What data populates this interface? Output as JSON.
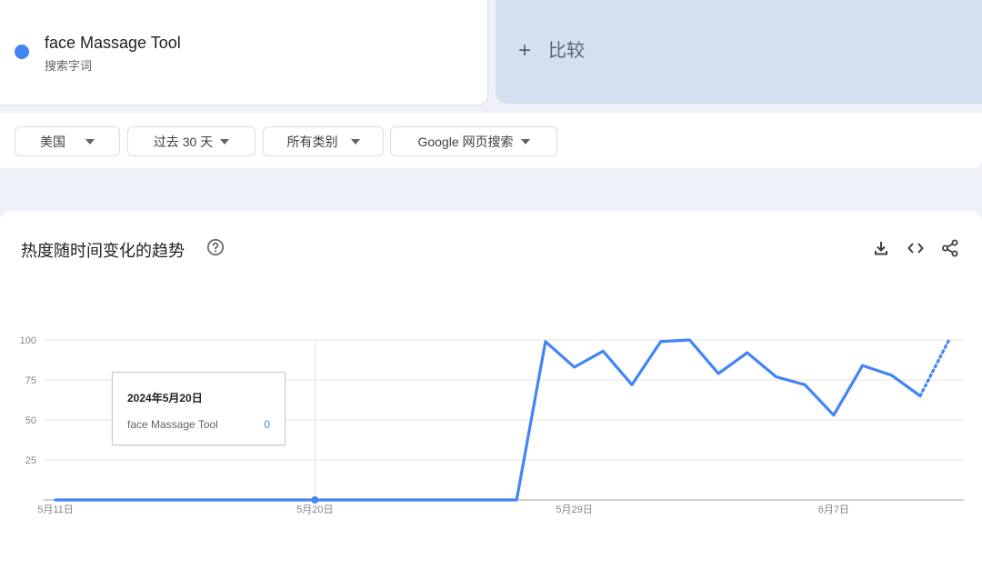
{
  "term": {
    "name": "face Massage Tool",
    "type": "搜索字词",
    "color": "#4285f4"
  },
  "compare": {
    "plus": "+",
    "label": "比较"
  },
  "filters": [
    {
      "label": "美国"
    },
    {
      "label": "过去 30 天"
    },
    {
      "label": "所有类别"
    },
    {
      "label": "Google 网页搜索"
    }
  ],
  "chart_section": {
    "title": "热度随时间变化的趋势",
    "icons": [
      "help-icon",
      "download-icon",
      "embed-icon",
      "share-icon"
    ]
  },
  "tooltip": {
    "date": "2024年5月20日",
    "term": "face Massage Tool",
    "value": "0"
  },
  "chart_data": {
    "type": "line",
    "x": [
      "5月11日",
      "5月12日",
      "5月13日",
      "5月14日",
      "5月15日",
      "5月16日",
      "5月17日",
      "5月18日",
      "5月19日",
      "5月20日",
      "5月21日",
      "5月22日",
      "5月23日",
      "5月24日",
      "5月25日",
      "5月26日",
      "5月27日",
      "5月28日",
      "5月29日",
      "5月30日",
      "5月31日",
      "6月1日",
      "6月2日",
      "6月3日",
      "6月4日",
      "6月5日",
      "6月6日",
      "6月7日",
      "6月8日",
      "6月9日",
      "6月10日"
    ],
    "series": [
      {
        "name": "face Massage Tool",
        "color": "#4285f4",
        "values": [
          0,
          0,
          0,
          0,
          0,
          0,
          0,
          0,
          0,
          0,
          0,
          0,
          0,
          0,
          0,
          0,
          0,
          99,
          83,
          93,
          72,
          99,
          100,
          79,
          92,
          77,
          72,
          53,
          84,
          78,
          65,
          100
        ],
        "partial_from_index": 30
      }
    ],
    "x_tick_labels": [
      "5月11日",
      "5月20日",
      "5月29日",
      "6月7日"
    ],
    "y_ticks": [
      25,
      50,
      75,
      100
    ],
    "ylim": [
      0,
      100
    ],
    "grid": true,
    "highlight_index": 9
  }
}
